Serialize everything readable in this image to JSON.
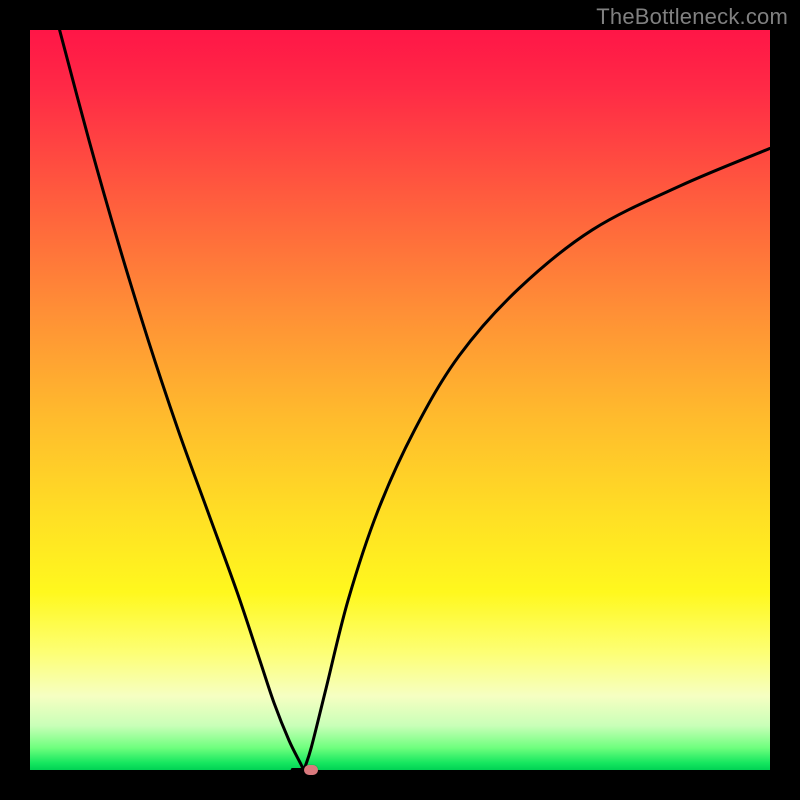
{
  "watermark": "TheBottleneck.com",
  "colors": {
    "frame": "#000000",
    "gradient_stops": [
      "#ff1647",
      "#ff2a46",
      "#ff5a3e",
      "#ff8f36",
      "#ffba2d",
      "#ffe024",
      "#fff81e",
      "#fdff73",
      "#f6ffc2",
      "#c9ffb8",
      "#6fff7e",
      "#17e760",
      "#00d254"
    ],
    "curve": "#000000",
    "marker": "#d9797d"
  },
  "chart_data": {
    "type": "line",
    "title": "",
    "xlabel": "",
    "ylabel": "",
    "xlim": [
      0,
      100
    ],
    "ylim": [
      0,
      100
    ],
    "legend": false,
    "grid": false,
    "vertex_x": 37,
    "left_curve": {
      "x": [
        4,
        8,
        12,
        16,
        20,
        24,
        28,
        31,
        33,
        35,
        36.5,
        37
      ],
      "y": [
        100,
        85,
        71,
        58,
        46,
        35,
        24,
        15,
        9,
        4,
        1,
        0
      ]
    },
    "right_curve": {
      "x": [
        37,
        38,
        40,
        43,
        47,
        52,
        58,
        66,
        76,
        88,
        100
      ],
      "y": [
        0,
        3,
        11,
        23,
        35,
        46,
        56,
        65,
        73,
        79,
        84
      ]
    },
    "flat_segment": {
      "x": [
        35.5,
        38.5
      ],
      "y": [
        0,
        0
      ]
    },
    "marker": {
      "x": 38,
      "y": 0
    }
  }
}
